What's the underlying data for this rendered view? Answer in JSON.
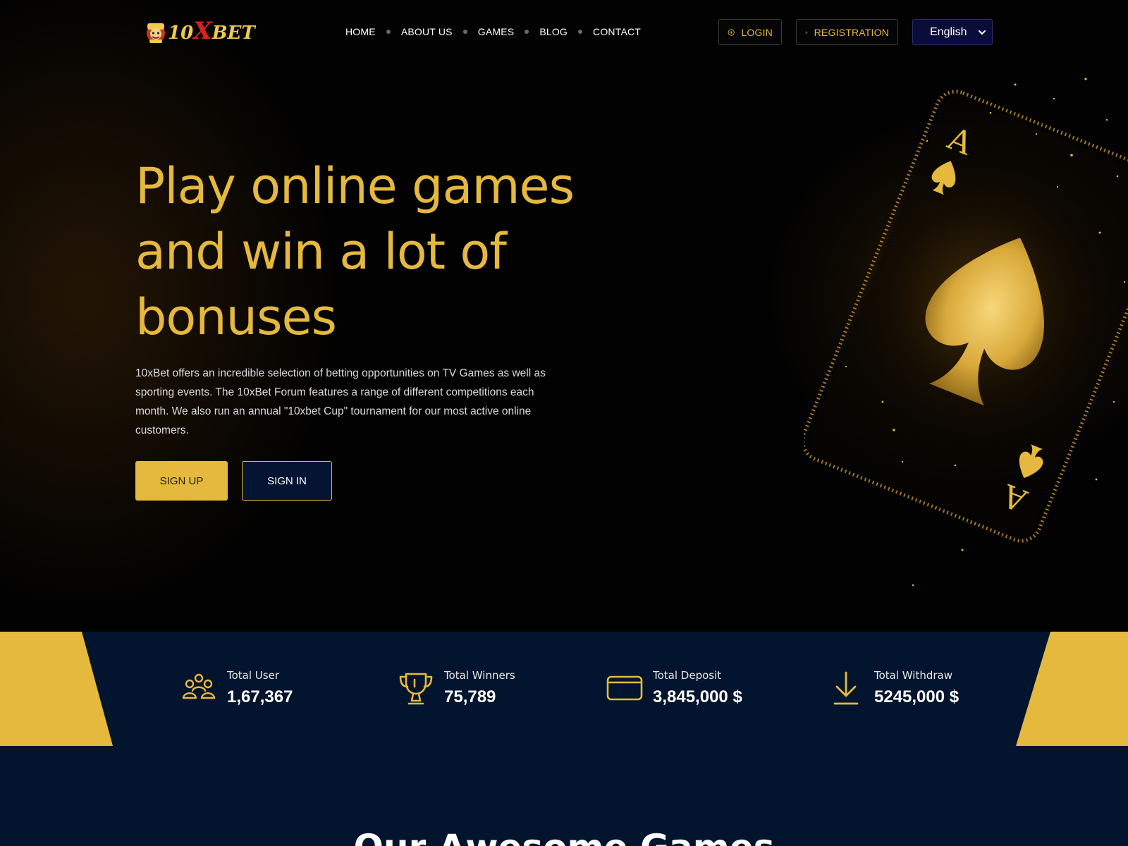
{
  "brand": {
    "logo_part1": "10",
    "logo_part2": "X",
    "logo_part3": "BET"
  },
  "nav": {
    "items": [
      "HOME",
      "ABOUT US",
      "GAMES",
      "BLOG",
      "CONTACT"
    ]
  },
  "header_actions": {
    "login_label": "LOGIN",
    "register_label": "REGISTRATION",
    "language_selected": "English",
    "login_icon": "login-icon",
    "register_icon": "user-add-icon"
  },
  "hero": {
    "title": "Play online games and win a lot of bonuses",
    "description": "10xBet offers an incredible selection of betting opportunities on TV Games as well as sporting events. The 10xBet Forum features a range of different competitions each month. We also run an annual \"10xbet Cup\" tournament for our most active online customers.",
    "signup_label": "SIGN UP",
    "signin_label": "SIGN IN",
    "art": "golden-ace-of-spades-card"
  },
  "stats": [
    {
      "icon": "users-icon",
      "label": "Total User",
      "value": "1,67,367"
    },
    {
      "icon": "trophy-icon",
      "label": "Total Winners",
      "value": "75,789"
    },
    {
      "icon": "credit-card-icon",
      "label": "Total Deposit",
      "value": "3,845,000 $"
    },
    {
      "icon": "download-icon",
      "label": "Total Withdraw",
      "value": "5245,000 $"
    }
  ],
  "games_section": {
    "title": "Our Awesome Games"
  },
  "colors": {
    "accent_gold": "#e5b93d",
    "navy": "#03142e",
    "background": "#020202",
    "logo_red": "#d8221f"
  }
}
